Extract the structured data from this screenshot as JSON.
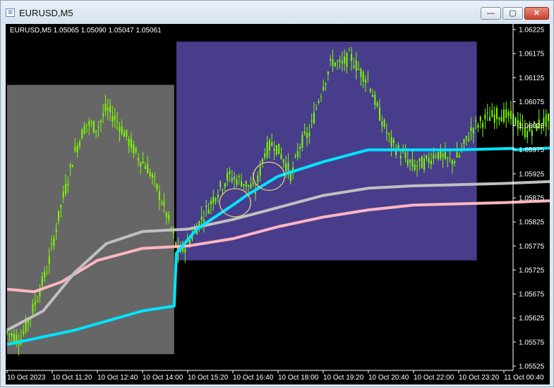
{
  "window": {
    "title": "EURUSD,M5",
    "app_icon": "chart-window-icon",
    "controls": {
      "minimize": "—",
      "maximize": "▢",
      "close": "✕"
    }
  },
  "chart_info": "EURUSD,M5  1.05065 1.05090 1.05047 1.05061",
  "colors": {
    "background": "#000000",
    "candles": "#7CFC00",
    "gray_zone": "#666666",
    "purple_zone": "#483D8B",
    "cyan_line": "#00E5FF",
    "gray_line": "#C0C0C0",
    "pink_line": "#FFB6C1",
    "circle": "#E6D37A"
  },
  "chart_data": {
    "type": "line",
    "symbol": "EURUSD",
    "timeframe": "M5",
    "y_ticks": [
      "1.06225",
      "1.06175",
      "1.06125",
      "1.06075",
      "1.06025",
      "1.05975",
      "1.05925",
      "1.05875",
      "1.05825",
      "1.05775",
      "1.05725",
      "1.05675",
      "1.05625",
      "1.05575",
      "1.05525"
    ],
    "x_ticks": [
      "10 Oct 2023",
      "10 Oct 11:20",
      "10 Oct 12:40",
      "10 Oct 14:00",
      "10 Oct 15:20",
      "10 Oct 16:40",
      "10 Oct 18:00",
      "10 Oct 19:20",
      "10 Oct 20:40",
      "10 Oct 22:00",
      "10 Oct 23:20",
      "11 Oct 00:40"
    ],
    "ylim": [
      1.05525,
      1.06225
    ],
    "grid": false,
    "price_points": [
      [
        0,
        1.05595
      ],
      [
        0.3,
        1.0558
      ],
      [
        0.6,
        1.0565
      ],
      [
        0.9,
        1.0573
      ],
      [
        1.2,
        1.0586
      ],
      [
        1.5,
        1.0597
      ],
      [
        1.75,
        1.0603
      ],
      [
        2.0,
        1.0602
      ],
      [
        2.2,
        1.0606
      ],
      [
        2.4,
        1.0604
      ],
      [
        2.6,
        1.0601
      ],
      [
        2.9,
        1.0596
      ],
      [
        3.1,
        1.0594
      ],
      [
        3.3,
        1.059
      ],
      [
        3.5,
        1.0585
      ],
      [
        3.8,
        1.0576
      ],
      [
        4.0,
        1.0578
      ],
      [
        4.3,
        1.0583
      ],
      [
        4.6,
        1.0588
      ],
      [
        4.9,
        1.0592
      ],
      [
        5.2,
        1.0591
      ],
      [
        5.5,
        1.0589
      ],
      [
        5.7,
        1.0597
      ],
      [
        5.9,
        1.0599
      ],
      [
        6.1,
        1.0596
      ],
      [
        6.3,
        1.0592
      ],
      [
        6.5,
        1.0599
      ],
      [
        6.7,
        1.0601
      ],
      [
        6.9,
        1.0608
      ],
      [
        7.0,
        1.0611
      ],
      [
        7.2,
        1.0616
      ],
      [
        7.4,
        1.0615
      ],
      [
        7.6,
        1.0617
      ],
      [
        7.8,
        1.0614
      ],
      [
        8.0,
        1.0612
      ],
      [
        8.2,
        1.0606
      ],
      [
        8.5,
        1.0599
      ],
      [
        8.8,
        1.0596
      ],
      [
        9.0,
        1.0594
      ],
      [
        9.3,
        1.0595
      ],
      [
        9.5,
        1.0597
      ],
      [
        9.8,
        1.0595
      ],
      [
        10.0,
        1.0596
      ],
      [
        10.3,
        1.0602
      ],
      [
        10.6,
        1.0604
      ],
      [
        10.9,
        1.0605
      ],
      [
        11.2,
        1.0604
      ],
      [
        11.5,
        1.0601
      ],
      [
        11.8,
        1.0603
      ],
      [
        12.1,
        1.0604
      ],
      [
        12.4,
        1.0604
      ]
    ],
    "series": [
      {
        "values": [
          [
            0,
            1.0557
          ],
          [
            1.5,
            1.056
          ],
          [
            3.0,
            1.0564
          ],
          [
            3.7,
            1.0565
          ],
          [
            3.75,
            1.0576
          ],
          [
            4.2,
            1.0581
          ],
          [
            5.0,
            1.0586
          ],
          [
            5.3,
            1.0588
          ],
          [
            6.0,
            1.0592
          ],
          [
            7.0,
            1.0595
          ],
          [
            8.0,
            1.05975
          ],
          [
            10.0,
            1.05975
          ],
          [
            11.2,
            1.05978
          ],
          [
            11.25,
            1.05975
          ],
          [
            12.3,
            1.0598
          ]
        ]
      },
      {
        "values": [
          [
            0,
            1.056
          ],
          [
            0.8,
            1.0564
          ],
          [
            1.5,
            1.0572
          ],
          [
            2.2,
            1.0578
          ],
          [
            3.0,
            1.05805
          ],
          [
            4.0,
            1.0581
          ],
          [
            5.0,
            1.0583
          ],
          [
            6.0,
            1.05855
          ],
          [
            7.0,
            1.0588
          ],
          [
            8.0,
            1.05895
          ],
          [
            9.0,
            1.059
          ],
          [
            11.0,
            1.05905
          ],
          [
            12.3,
            1.0591
          ]
        ]
      },
      {
        "values": [
          [
            0,
            1.05685
          ],
          [
            0.6,
            1.0568
          ],
          [
            1.2,
            1.057
          ],
          [
            2.0,
            1.05745
          ],
          [
            3.0,
            1.0577
          ],
          [
            4.0,
            1.05775
          ],
          [
            5.0,
            1.0579
          ],
          [
            6.0,
            1.05815
          ],
          [
            7.0,
            1.05835
          ],
          [
            8.0,
            1.0585
          ],
          [
            9.0,
            1.0586
          ],
          [
            11.0,
            1.05865
          ],
          [
            12.3,
            1.0587
          ]
        ]
      }
    ],
    "zones": [
      {
        "x0": 0,
        "x1": 3.7,
        "y0": 1.0555,
        "y1": 1.0611
      },
      {
        "x0": 3.75,
        "x1": 10.4,
        "y0": 1.05745,
        "y1": 1.062
      }
    ],
    "circles": [
      {
        "x": 5.05,
        "y": 1.05865
      },
      {
        "x": 5.8,
        "y": 1.0592
      }
    ]
  }
}
